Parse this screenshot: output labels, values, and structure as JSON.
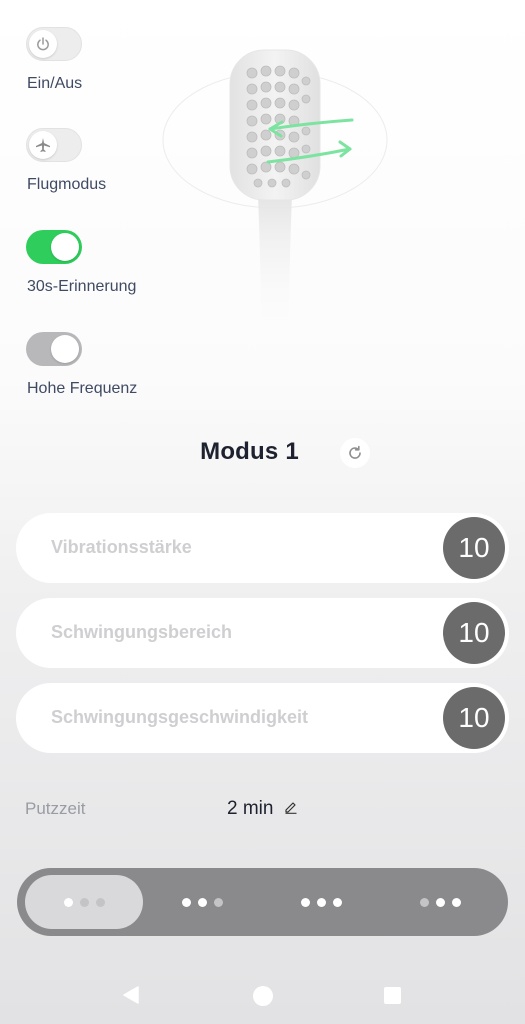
{
  "colors": {
    "toggle_on": "#2fcd5c",
    "toggle_off": "#b8b8bb",
    "value_badge": "#6b6b6b",
    "bristle_arrow": "#7de3a0"
  },
  "toggles": [
    {
      "label": "Ein/Aus",
      "state": "disabled",
      "icon": "power-icon"
    },
    {
      "label": "Flugmodus",
      "state": "disabled",
      "icon": "airplane-icon"
    },
    {
      "label": "30s-Erinnerung",
      "state": "on"
    },
    {
      "label": "Hohe Frequenz",
      "state": "off"
    }
  ],
  "mode": {
    "title": "Modus 1",
    "reset_icon": "refresh-icon"
  },
  "settings": [
    {
      "label": "Vibrationsstärke",
      "value": "10"
    },
    {
      "label": "Schwingungsbereich",
      "value": "10"
    },
    {
      "label": "Schwingungsgeschwindigkeit",
      "value": "10"
    }
  ],
  "brush_time": {
    "label": "Putzzeit",
    "value": "2 min",
    "edit_icon": "pencil-icon"
  },
  "mode_selector": {
    "selected_index": 0,
    "segments": [
      {
        "dots": [
          true,
          false,
          false
        ]
      },
      {
        "dots": [
          true,
          true,
          false
        ]
      },
      {
        "dots": [
          true,
          true,
          true
        ]
      },
      {
        "dots": [
          false,
          true,
          true
        ]
      }
    ]
  },
  "navbar": {
    "back_icon": "back-triangle-icon",
    "home_icon": "home-circle-icon",
    "recents_icon": "recents-square-icon"
  }
}
